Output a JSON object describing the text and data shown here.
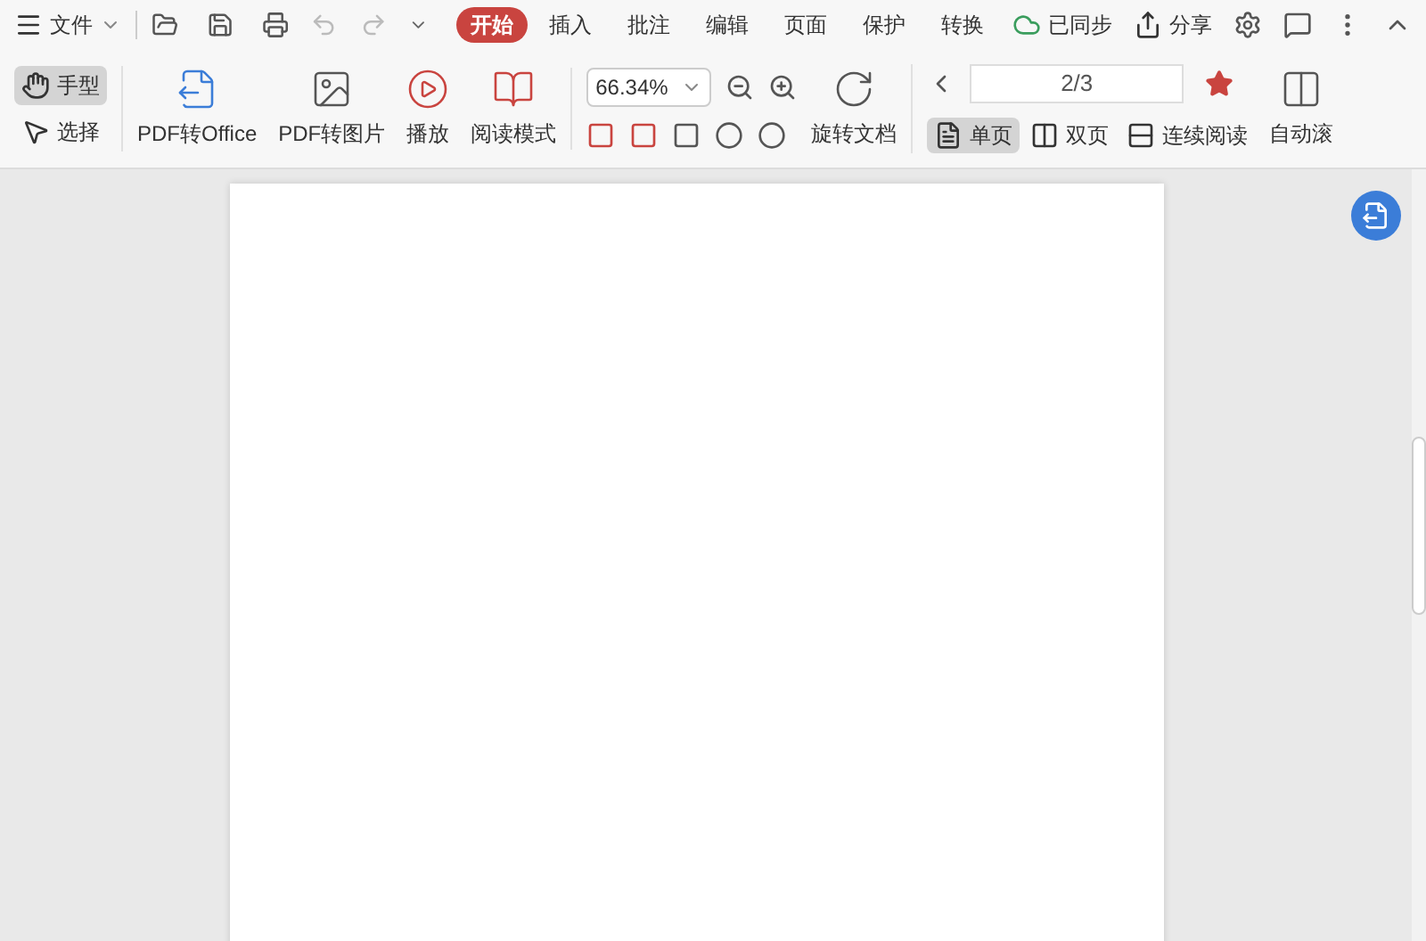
{
  "menu": {
    "file": "文件"
  },
  "tabs": [
    {
      "label": "开始",
      "selected": true
    },
    {
      "label": "插入",
      "selected": false
    },
    {
      "label": "批注",
      "selected": false
    },
    {
      "label": "编辑",
      "selected": false
    },
    {
      "label": "页面",
      "selected": false
    },
    {
      "label": "保护",
      "selected": false
    },
    {
      "label": "转换",
      "selected": false
    }
  ],
  "top_right": {
    "sync": "已同步",
    "share": "分享"
  },
  "tools": {
    "hand": {
      "label": "手型",
      "selected": true
    },
    "select": {
      "label": "选择",
      "selected": false
    },
    "pdf_office": "PDF转Office",
    "pdf_image": "PDF转图片",
    "play": "播放",
    "read_mode": "阅读模式",
    "zoom": "66.34%",
    "rotate": "旋转文档",
    "page": "2/3"
  },
  "views": [
    {
      "label": "单页",
      "selected": true
    },
    {
      "label": "双页",
      "selected": false
    },
    {
      "label": "连续阅读",
      "selected": false
    }
  ],
  "auto_scroll": "自动滚"
}
